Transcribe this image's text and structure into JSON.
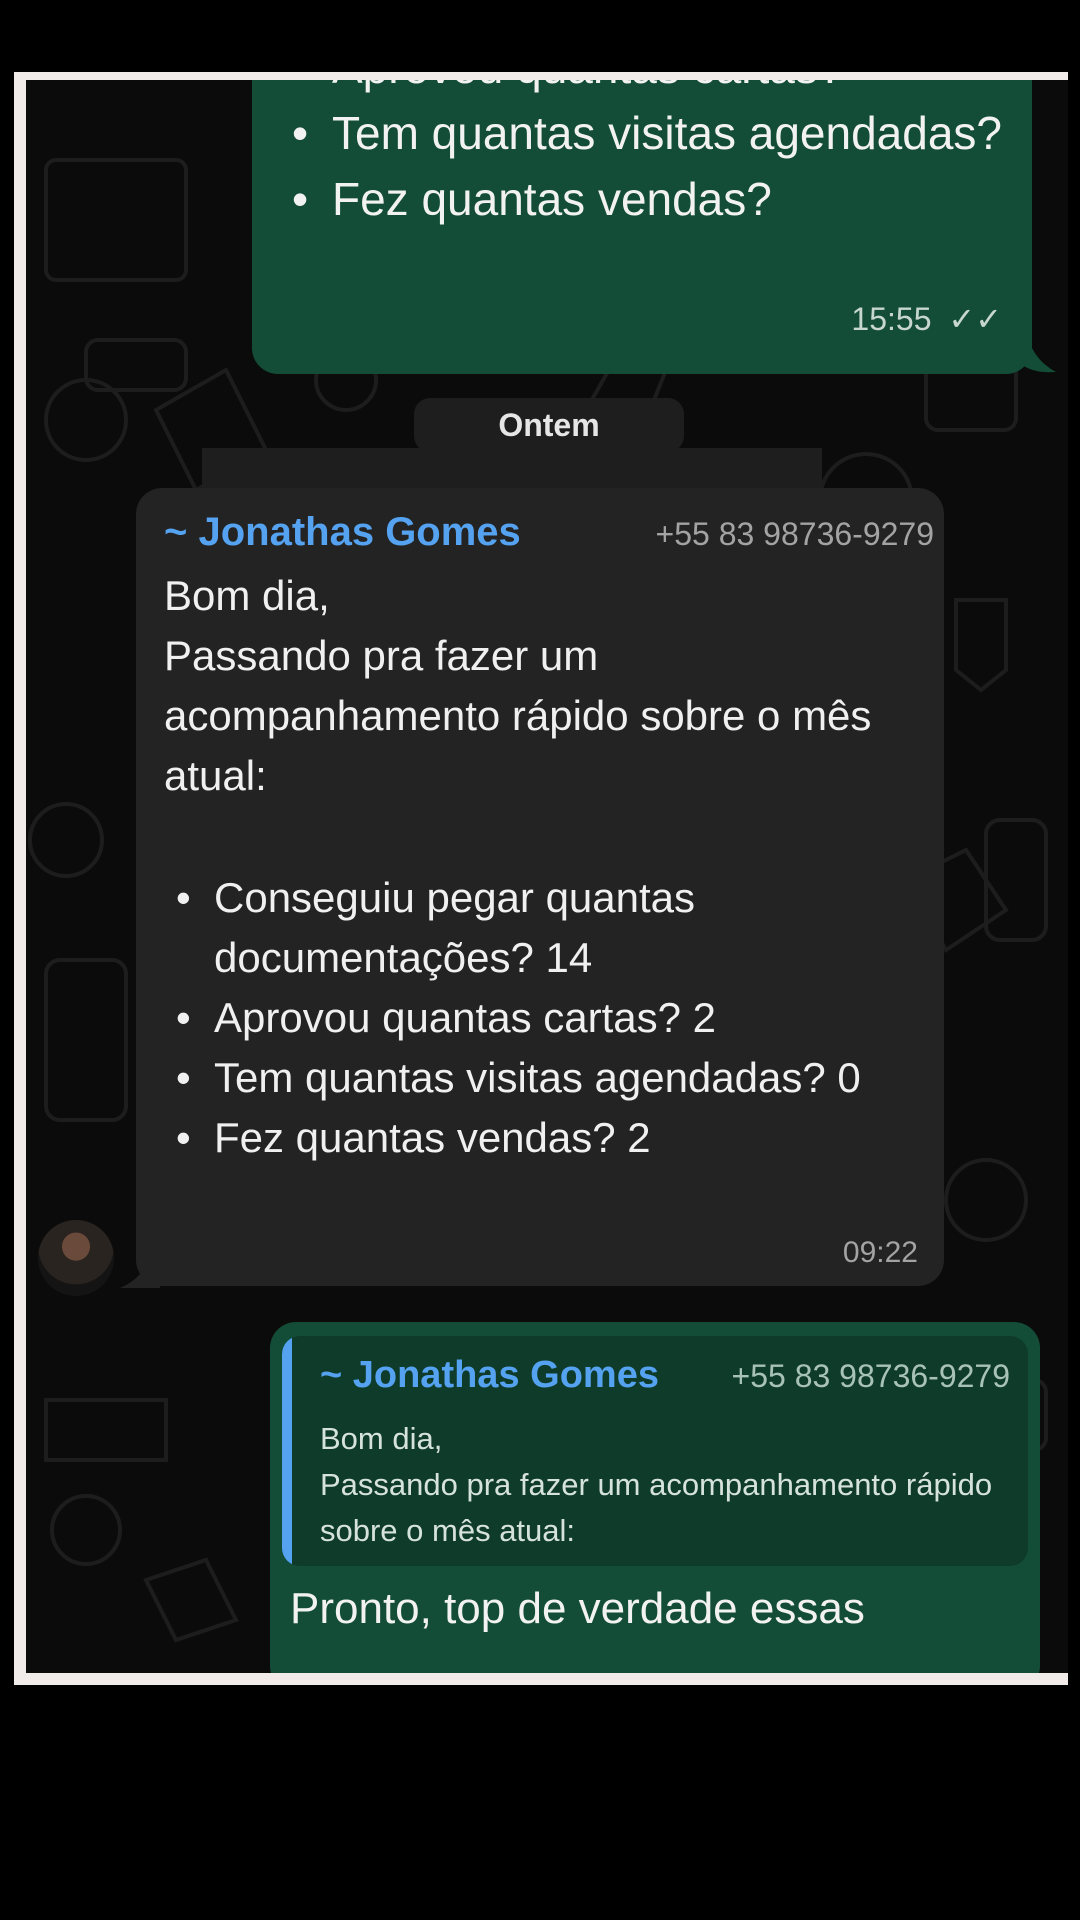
{
  "outgoing_prev": {
    "items": [
      "Aprovou quantas cartas?",
      "Tem quantas visitas agendadas?",
      "Fez quantas vendas?"
    ],
    "time": "15:55",
    "status_icon": "double-check-icon"
  },
  "date_divider": "Ontem",
  "incoming": {
    "sender_name": "~ Jonathas Gomes",
    "sender_phone": "+55 83 98736-9279",
    "lines": [
      "Bom dia,",
      "Passando pra fazer um acompanhamento rápido sobre o mês atual:"
    ],
    "items": [
      "Conseguiu pegar quantas documentações? 14",
      "Aprovou quantas cartas? 2",
      "Tem quantas visitas agendadas? 0",
      "Fez quantas vendas? 2"
    ],
    "time": "09:22"
  },
  "reply": {
    "quoted_name": "~ Jonathas Gomes",
    "quoted_phone": "+55 83 98736-9279",
    "quoted_lines": [
      "Bom dia,",
      "Passando pra fazer um acompanhamento rápido sobre o mês atual:"
    ],
    "text": "Pronto, top de verdade essas"
  },
  "colors": {
    "outgoing_bubble": "#134d37",
    "incoming_bubble": "#232323",
    "sender_name": "#54a2f0",
    "background": "#0b0b0b"
  }
}
